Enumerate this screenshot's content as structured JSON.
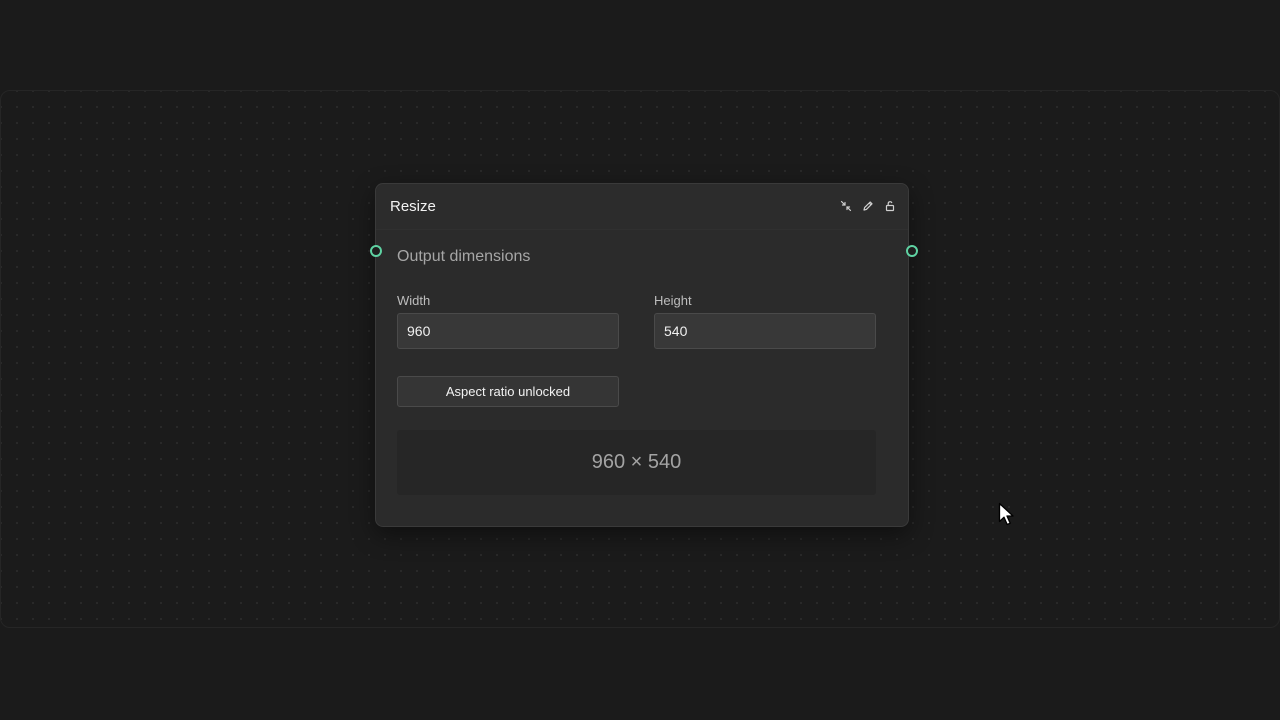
{
  "node": {
    "title": "Resize",
    "header_icons": [
      "collapse-icon",
      "pencil-icon",
      "unlock-icon"
    ],
    "section_title": "Output dimensions",
    "width": {
      "label": "Width",
      "value": "960"
    },
    "height": {
      "label": "Height",
      "value": "540"
    },
    "aspect_button_label": "Aspect ratio unlocked",
    "preview_text": "960 × 540"
  },
  "colors": {
    "background": "#1b1b1b",
    "node_background": "#2b2b2b",
    "port_accent": "#5fd3a3"
  }
}
